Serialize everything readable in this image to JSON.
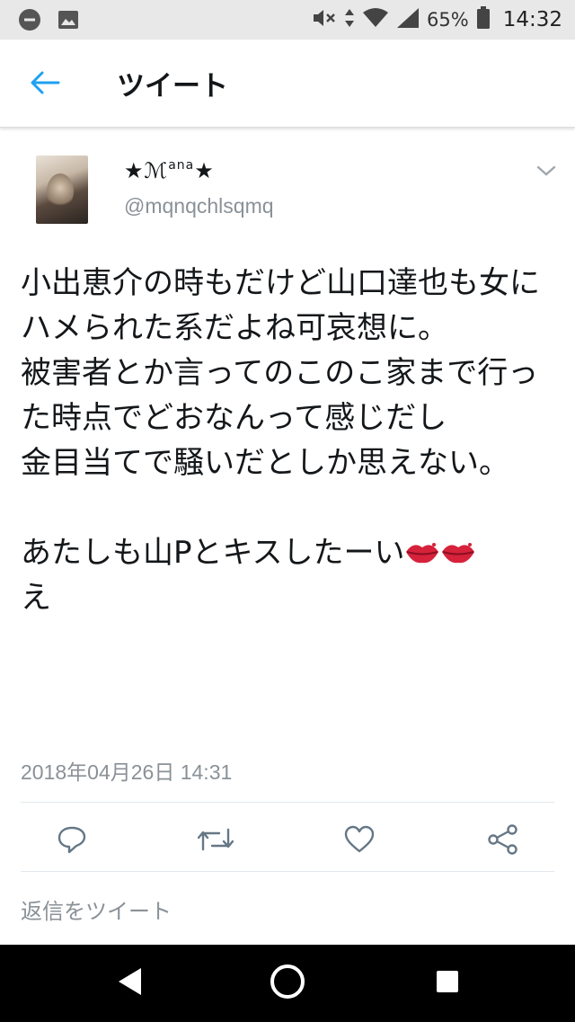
{
  "status_bar": {
    "battery_percent": "65%",
    "time": "14:32",
    "icons": [
      "minus-circle-icon",
      "image-icon",
      "mute-icon",
      "data-arrows-icon",
      "wifi-icon",
      "signal-icon",
      "battery-icon"
    ]
  },
  "header": {
    "back_icon": "arrow-left-icon",
    "title": "ツイート",
    "accent_color": "#1da1f2"
  },
  "tweet": {
    "display_name": "★ℳ",
    "display_name_sup": "ana",
    "display_name_end": "★",
    "username": "@mqnqchlsqmq",
    "text_before_emoji": "小出恵介の時もだけど山口達也も女にハメられた系だよね可哀想に。\n被害者とか言ってのこのこ家まで行った時点でどおなんって感じだし\n金目当てで騒いだとしか思えない。\n\nあたしも山Pとキスしたーい",
    "text_after_emoji": "え",
    "emoji": [
      "kiss-lips-icon",
      "kiss-lips-icon"
    ],
    "timestamp": "2018年04月26日 14:31"
  },
  "actions": {
    "icons": [
      "reply-icon",
      "retweet-icon",
      "like-icon",
      "share-icon"
    ],
    "color": "#657786"
  },
  "reply_prompt": "返信をツイート",
  "nav_bar": {
    "icons": [
      "back-triangle-icon",
      "home-circle-icon",
      "recents-square-icon"
    ]
  }
}
